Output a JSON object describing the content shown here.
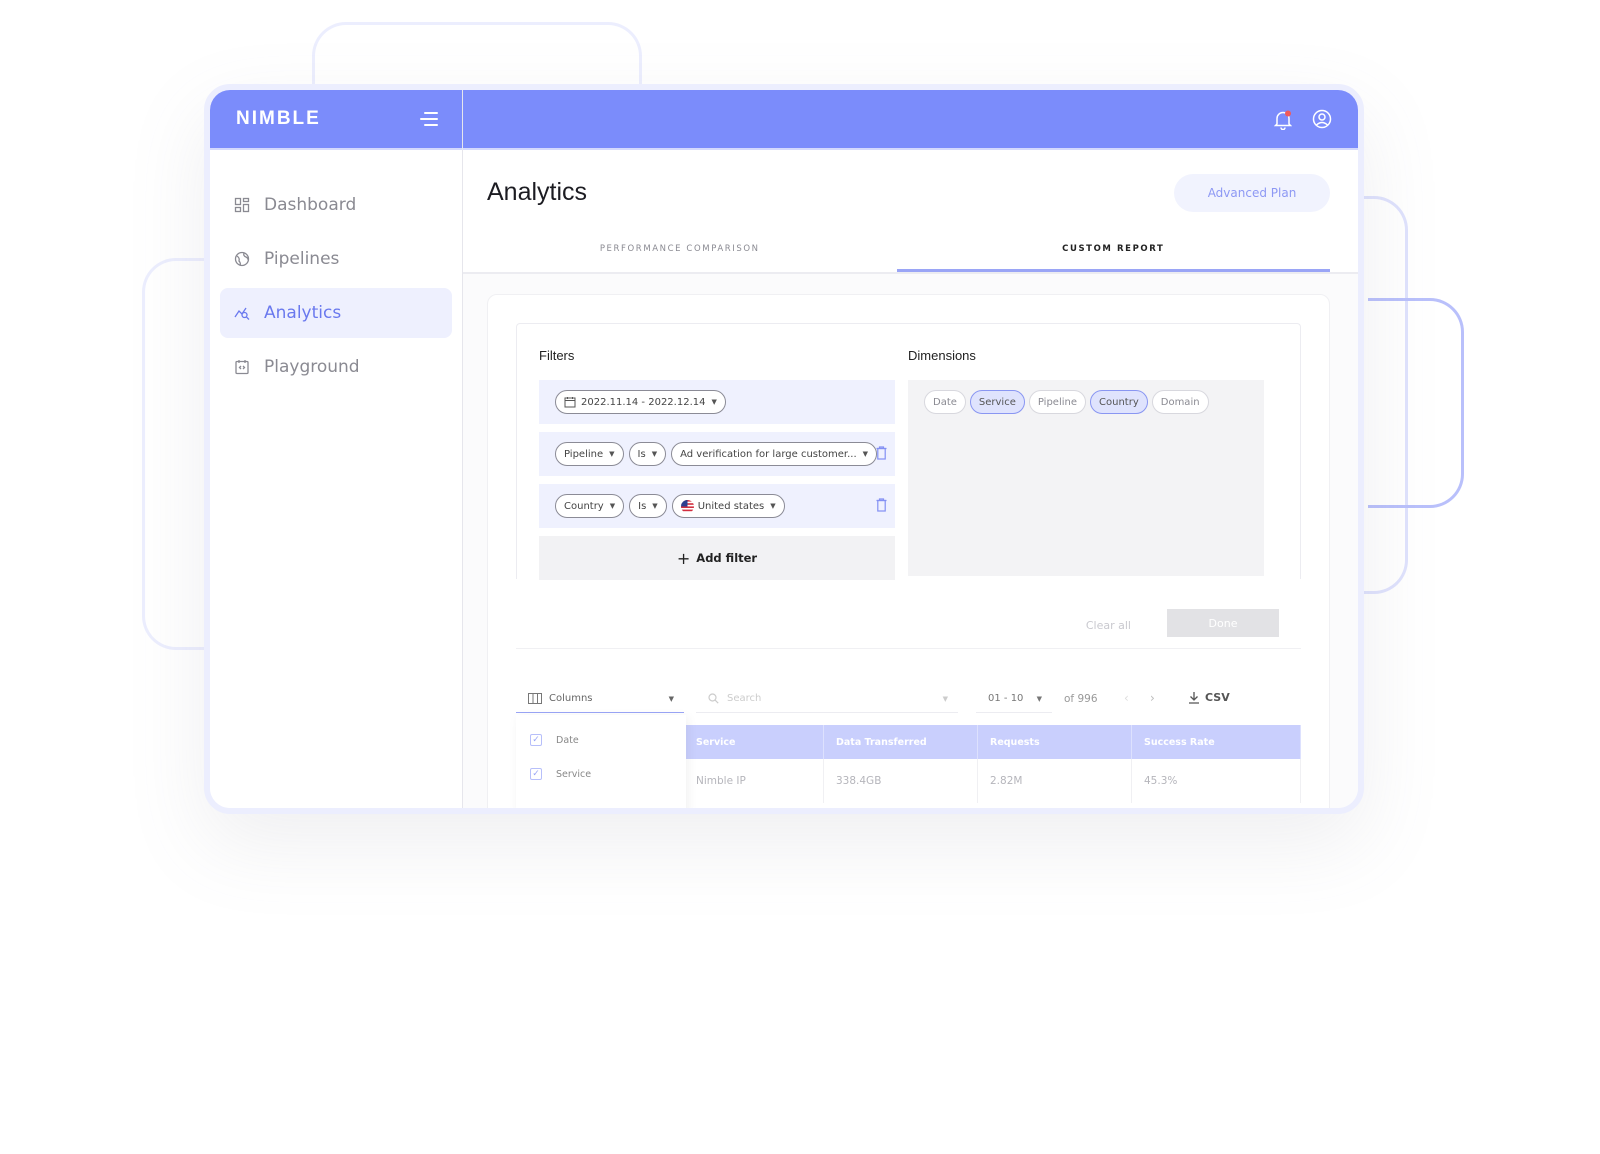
{
  "brand": {
    "logo": "NIMBLE"
  },
  "sidebar": {
    "items": [
      {
        "label": "Dashboard",
        "icon": "dashboard-icon",
        "active": false
      },
      {
        "label": "Pipelines",
        "icon": "globe-icon",
        "active": false
      },
      {
        "label": "Analytics",
        "icon": "analytics-icon",
        "active": true
      },
      {
        "label": "Playground",
        "icon": "code-icon",
        "active": false
      }
    ]
  },
  "page": {
    "title": "Analytics",
    "plan_button": "Advanced Plan",
    "tabs": [
      {
        "label": "PERFORMANCE COMPARISON",
        "active": false
      },
      {
        "label": "CUSTOM REPORT",
        "active": true
      }
    ]
  },
  "filters": {
    "title": "Filters",
    "date_range": "2022.11.14 - 2022.12.14",
    "rows": [
      {
        "field": "Pipeline",
        "operator": "Is",
        "value": "Ad verification for large customer..."
      },
      {
        "field": "Country",
        "operator": "Is",
        "value": "United states"
      }
    ],
    "add_label": "Add filter"
  },
  "dimensions": {
    "title": "Dimensions",
    "chips": [
      {
        "label": "Date",
        "selected": false
      },
      {
        "label": "Service",
        "selected": true
      },
      {
        "label": "Pipeline",
        "selected": false
      },
      {
        "label": "Country",
        "selected": true
      },
      {
        "label": "Domain",
        "selected": false
      }
    ]
  },
  "actions": {
    "clear": "Clear all",
    "done": "Done"
  },
  "toolbar": {
    "columns": "Columns",
    "search_placeholder": "Search",
    "page_range": "01 - 10",
    "total": "of 996",
    "export": "CSV"
  },
  "column_menu": {
    "options": [
      "Date",
      "Service"
    ]
  },
  "table": {
    "headers": [
      "Service",
      "Data Transferred",
      "Requests",
      "Success Rate"
    ],
    "rows": [
      [
        "Nimble IP",
        "338.4GB",
        "2.82M",
        "45.3%"
      ]
    ]
  },
  "colors": {
    "accent": "#7b8cfb",
    "accent_light": "#eef0fe",
    "notification": "#f05a5a"
  }
}
